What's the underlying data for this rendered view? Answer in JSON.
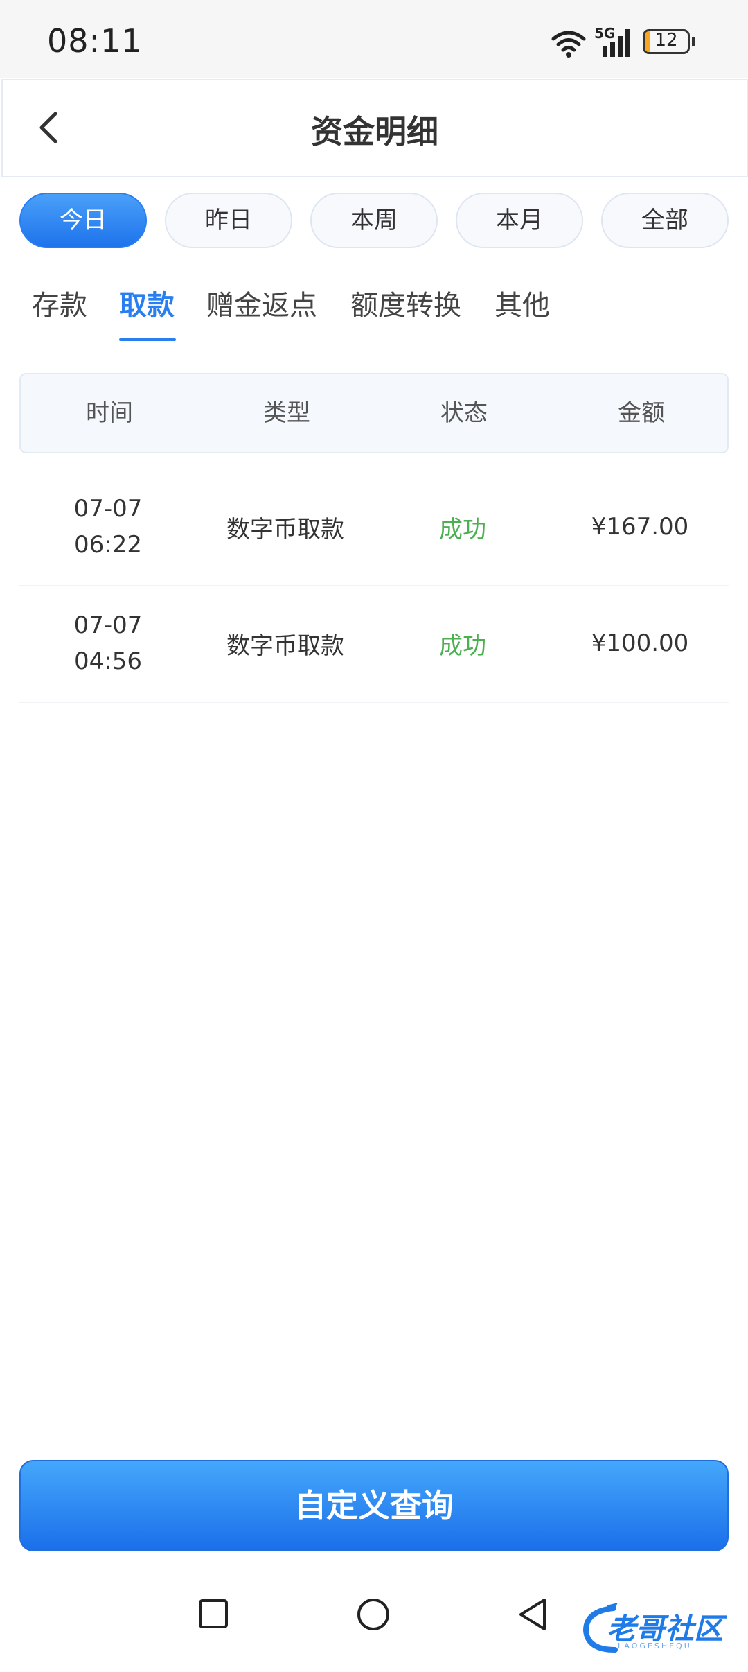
{
  "status_bar": {
    "time": "08:11",
    "network_label": "5G",
    "battery_level": "12",
    "battery_fraction": 0.12,
    "battery_color": "#f5a623"
  },
  "header": {
    "back_icon": "chevron-left-icon",
    "title": "资金明细"
  },
  "periods": [
    {
      "label": "今日",
      "active": true
    },
    {
      "label": "昨日",
      "active": false
    },
    {
      "label": "本周",
      "active": false
    },
    {
      "label": "本月",
      "active": false
    },
    {
      "label": "全部",
      "active": false
    }
  ],
  "categories": [
    {
      "label": "存款",
      "active": false
    },
    {
      "label": "取款",
      "active": true
    },
    {
      "label": "赠金返点",
      "active": false
    },
    {
      "label": "额度转换",
      "active": false
    },
    {
      "label": "其他",
      "active": false
    }
  ],
  "table": {
    "columns": [
      "时间",
      "类型",
      "状态",
      "金额"
    ],
    "rows": [
      {
        "date": "07-07",
        "time": "06:22",
        "type": "数字币取款",
        "status": "成功",
        "amount": "¥167.00"
      },
      {
        "date": "07-07",
        "time": "04:56",
        "type": "数字币取款",
        "status": "成功",
        "amount": "¥100.00"
      }
    ]
  },
  "custom_query": {
    "label": "自定义查询"
  },
  "system_nav": {
    "recents_icon": "square-icon",
    "home_icon": "circle-icon",
    "back_icon": "triangle-back-icon"
  },
  "watermark": {
    "text": "老哥社区",
    "subtext": "LAOGESHEQU"
  },
  "colors": {
    "accent": "#2a7ff0",
    "success": "#4caf50"
  }
}
